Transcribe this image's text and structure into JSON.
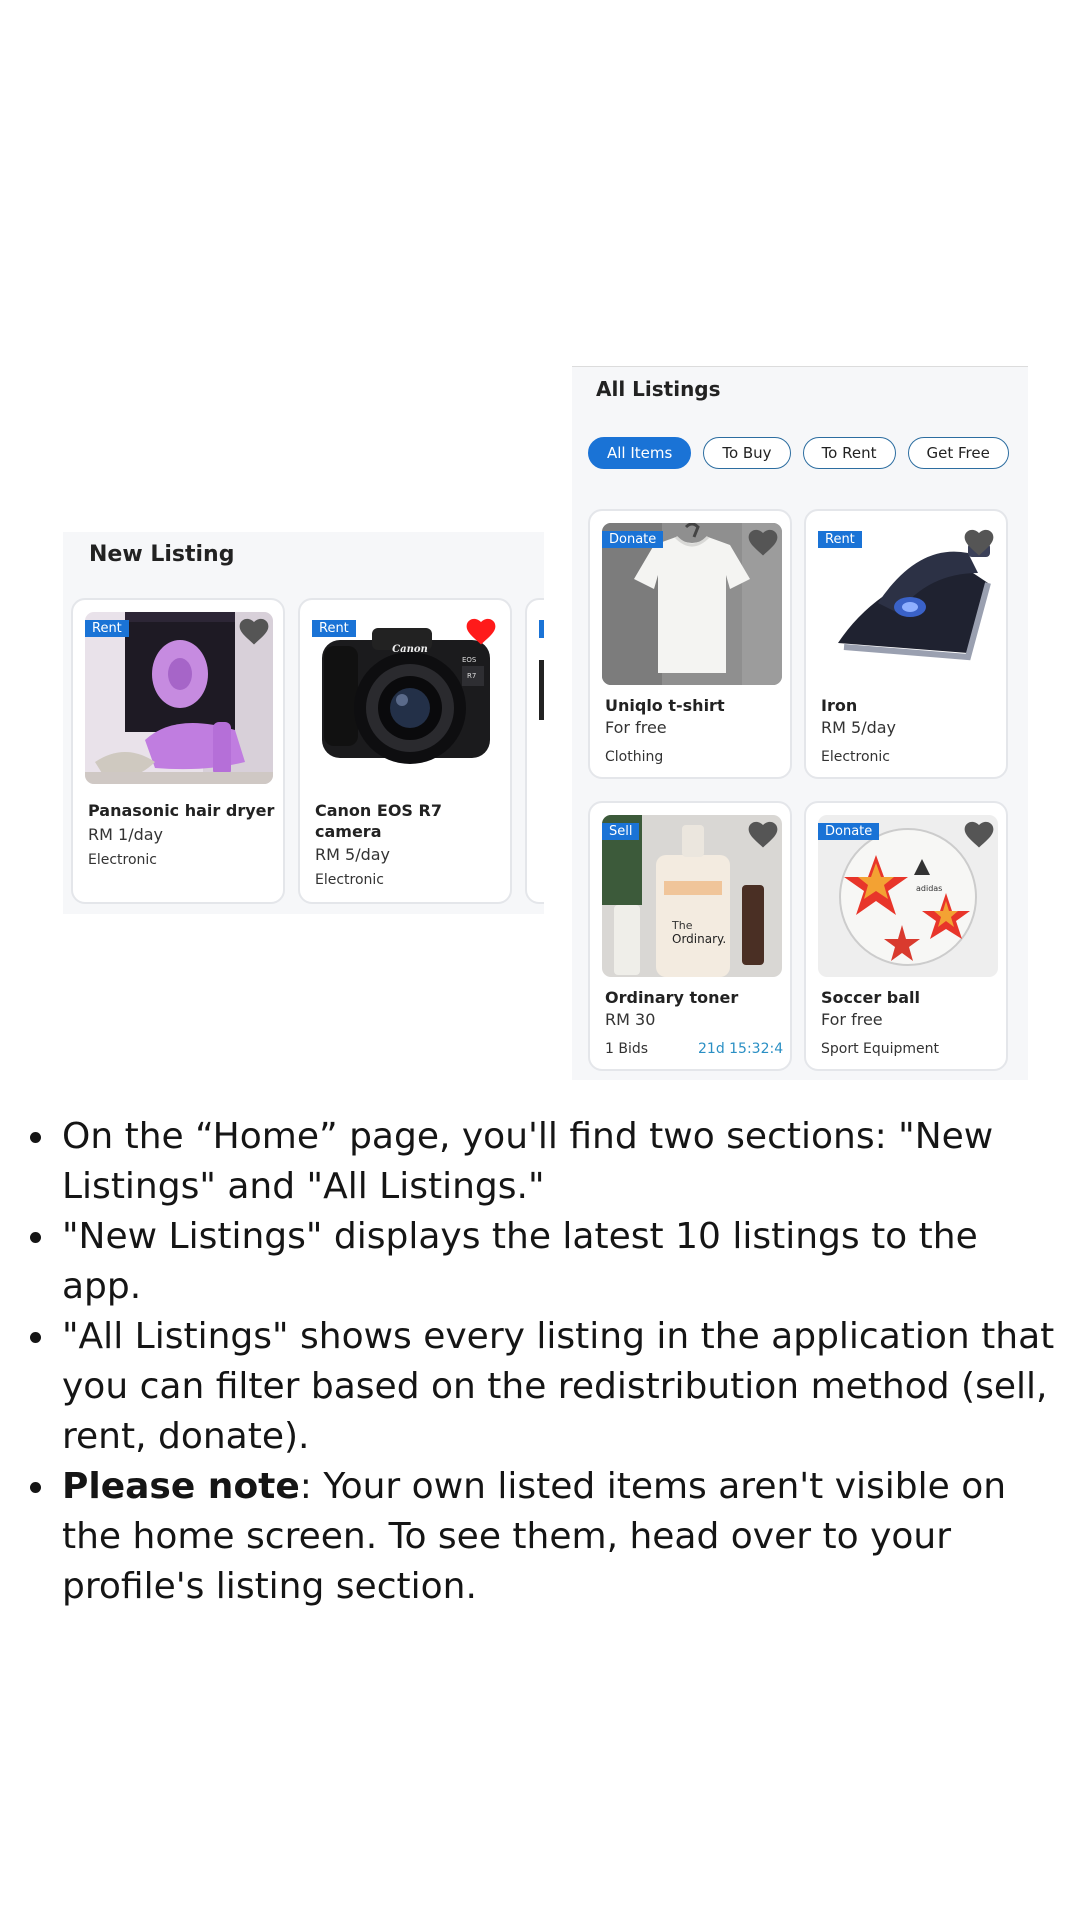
{
  "new_listing": {
    "title": "New Listing",
    "cards": [
      {
        "tag": "Rent",
        "title": "Panasonic hair dryer",
        "price": "RM 1/day",
        "category": "Electronic",
        "favorited": false
      },
      {
        "tag": "Rent",
        "title_line1": "Canon EOS R7",
        "title_line2": "camera",
        "price": "RM 5/day",
        "category": "Electronic",
        "favorited": true
      }
    ]
  },
  "all_listings": {
    "title": "All Listings",
    "filters": [
      "All Items",
      "To Buy",
      "To Rent",
      "Get Free"
    ],
    "active_filter": "All Items",
    "cards": [
      {
        "tag": "Donate",
        "title": "Uniqlo t-shirt",
        "price": "For free",
        "category": "Clothing"
      },
      {
        "tag": "Rent",
        "title": "Iron",
        "price": "RM 5/day",
        "category": "Electronic"
      },
      {
        "tag": "Sell",
        "title": "Ordinary toner",
        "price": "RM 30",
        "bids": "1 Bids",
        "timer": "21d 15:32:4"
      },
      {
        "tag": "Donate",
        "title": "Soccer ball",
        "price": "For free",
        "category": "Sport Equipment"
      }
    ]
  },
  "notes": {
    "b1": "On the “Home” page, you'll find two sections: \"New Listings\" and \"All Listings.\"",
    "b2": "\"New Listings\" displays the latest 10 listings to the app.",
    "b3": "\"All Listings\" shows every listing in the application that you can filter based on the redistribution method (sell, rent, donate).",
    "b4_bold": "Please note",
    "b4_rest": ": Your own listed items aren't visible on the home screen. To see them, head over to your profile's listing section."
  },
  "colors": {
    "accent": "#1a73d6",
    "heart_default": "#555555",
    "heart_active": "#ff1a1a",
    "timer": "#2a8fc4",
    "panel_bg": "#f6f7f9"
  }
}
